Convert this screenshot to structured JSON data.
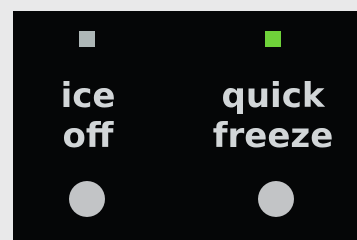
{
  "controls": [
    {
      "label_line1": "ice",
      "label_line2": "off",
      "indicator_color": "#aeb7b7",
      "indicator_state": "off"
    },
    {
      "label_line1": "quick",
      "label_line2": "freeze",
      "indicator_color": "#6fd23a",
      "indicator_state": "on"
    }
  ],
  "colors": {
    "panel_background": "#050607",
    "label_text": "#d2d6d8",
    "button": "#c2c4c6",
    "frame": "#e9e9ea"
  },
  "icons": {
    "indicator": "square-led-icon",
    "button": "round-push-button"
  }
}
